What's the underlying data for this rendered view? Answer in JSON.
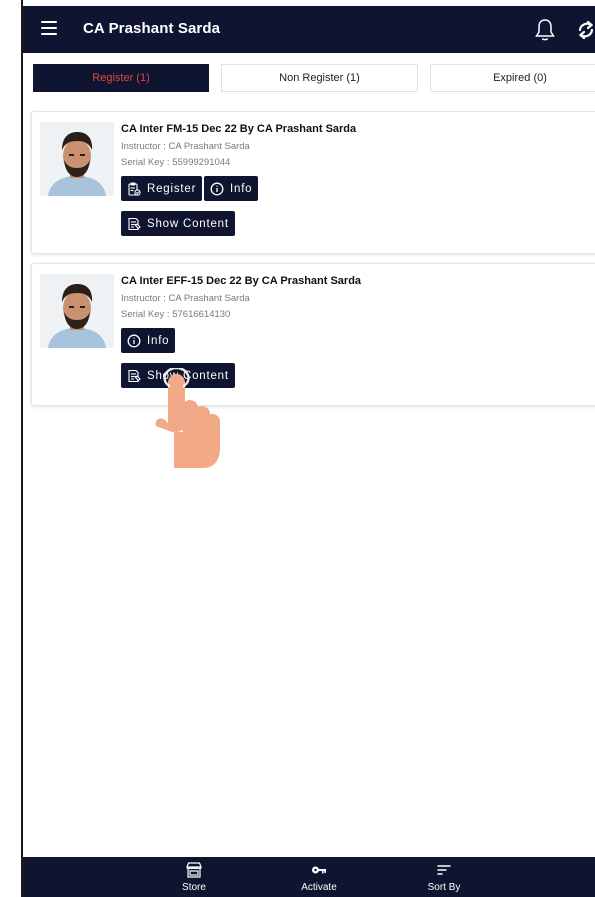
{
  "header": {
    "title": "CA Prashant Sarda"
  },
  "tabs": [
    {
      "label": "Register (1)",
      "active": true
    },
    {
      "label": "Non Register (1)",
      "active": false
    },
    {
      "label": "Expired (0)",
      "active": false
    }
  ],
  "courses": [
    {
      "title": "CA Inter FM-15 Dec 22 By CA Prashant Sarda",
      "instructor": "Instructor : CA Prashant Sarda",
      "serial": "Serial Key : 55999291044",
      "register_label": "Register",
      "info_label": "Info",
      "show_content_label": "Show Content"
    },
    {
      "title": "CA Inter EFF-15 Dec 22 By CA Prashant Sarda",
      "instructor": "Instructor : CA Prashant Sarda",
      "serial": "Serial Key : 57616614130",
      "info_label": "Info",
      "show_content_label": "Show Content"
    }
  ],
  "bottom_nav": [
    {
      "label": "Store",
      "icon": "store-icon"
    },
    {
      "label": "Activate",
      "icon": "key-icon"
    },
    {
      "label": "Sort By",
      "icon": "sort-icon"
    }
  ],
  "colors": {
    "navy": "#0f1430",
    "active_tab_text": "#e2453c",
    "hand": "#f2a988"
  }
}
